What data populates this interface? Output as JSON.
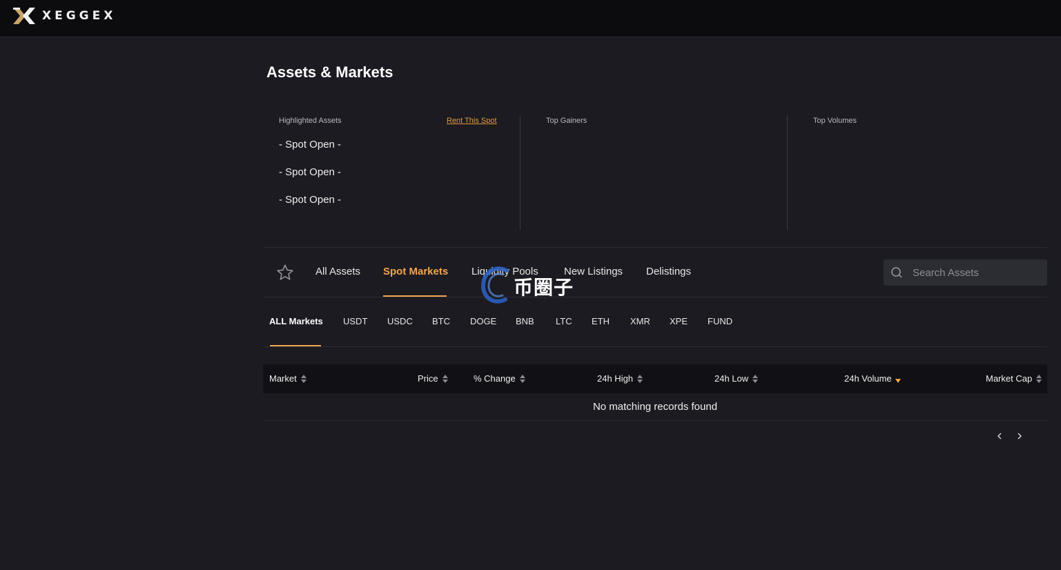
{
  "brand": {
    "name": "XEGGEX"
  },
  "page": {
    "title": "Assets & Markets"
  },
  "highlighted": {
    "label": "Highlighted Assets",
    "rent_link": "Rent This Spot",
    "spots": [
      "- Spot Open -",
      "- Spot Open -",
      "- Spot Open -"
    ]
  },
  "top_gainers": {
    "label": "Top Gainers"
  },
  "top_volumes": {
    "label": "Top Volumes"
  },
  "tabs": [
    {
      "label": "All Assets",
      "active": false
    },
    {
      "label": "Spot Markets",
      "active": true
    },
    {
      "label": "Liquidity Pools",
      "active": false
    },
    {
      "label": "New Listings",
      "active": false
    },
    {
      "label": "Delistings",
      "active": false
    }
  ],
  "search": {
    "placeholder": "Search Assets",
    "value": ""
  },
  "market_tabs": [
    "ALL Markets",
    "USDT",
    "USDC",
    "BTC",
    "DOGE",
    "BNB",
    "LTC",
    "ETH",
    "XMR",
    "XPE",
    "FUND"
  ],
  "active_market_tab": "ALL Markets",
  "table": {
    "columns": [
      "Market",
      "Price",
      "% Change",
      "24h High",
      "24h Low",
      "24h Volume",
      "Market Cap"
    ],
    "sorted_column": "24h Volume",
    "sort_direction": "desc",
    "empty_text": "No matching records found"
  },
  "watermark": {
    "text": "币圈子"
  },
  "colors": {
    "accent": "#f3a64a",
    "background": "#1b1b21",
    "topbar": "#0c0c0f",
    "logo_gold": "#c9a46a"
  },
  "icons": {
    "favorites": "star-icon",
    "search": "search-icon",
    "prev": "chevron-left-icon",
    "next": "chevron-right-icon"
  }
}
